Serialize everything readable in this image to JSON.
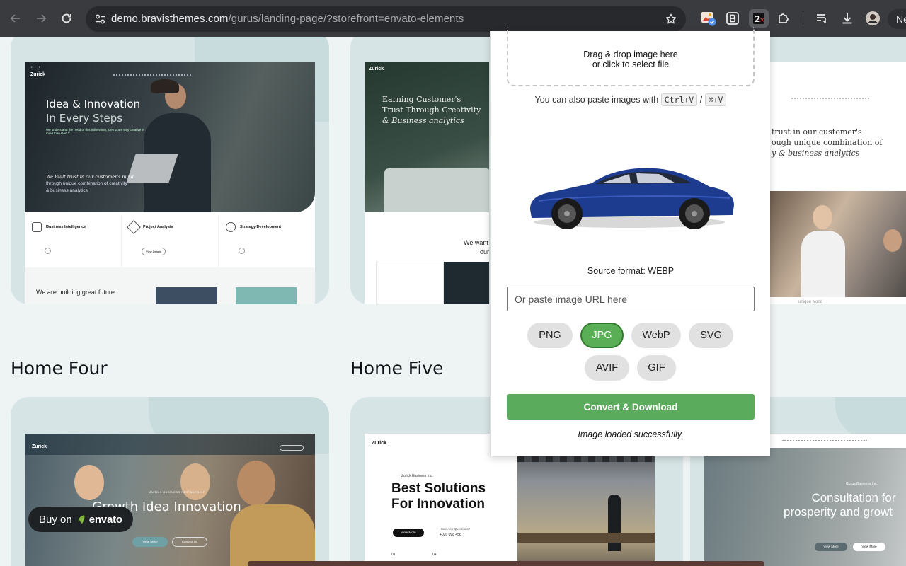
{
  "browser": {
    "url_host": "demo.bravisthemes.com",
    "url_path": "/gurus/landing-page/?storefront=envato-elements",
    "profile_label": "Ne"
  },
  "page": {
    "sections": [
      {
        "title": "Home Four"
      },
      {
        "title": "Home Five"
      }
    ],
    "buy_badge": {
      "prefix": "Buy on",
      "brand": "envato"
    }
  },
  "previews": {
    "home_one": {
      "logo": "Zurick",
      "heading_line1": "Idea & Innovation",
      "heading_line2": "In Every Steps",
      "intro": "We understand the need of this millennium, Gen Z are way creative in mind than Gen X",
      "quote_line1": "We Built trust in our customer's mind",
      "quote_line2": "through unique combination of creativity",
      "quote_line3": "& business analytics",
      "features": [
        "Business Intelligence",
        "Project Analysis",
        "Strategy Development"
      ],
      "view_details": "View Details",
      "tagline": "We are building great future"
    },
    "home_two": {
      "logo": "Zurick",
      "heading_line1": "Earning Customer's",
      "heading_line2": "Trust Through Creativity",
      "heading_line3": "& Business analytics",
      "snippet_line1": "We want",
      "snippet_line2": "our"
    },
    "home_three": {
      "heading_line1": "trust in our customer's",
      "heading_line2": "ough unique combination of",
      "heading_line3": "y & business analytics",
      "footer": "unique world"
    },
    "home_four": {
      "logo": "Zurick",
      "heading": "Growth Idea Innovation",
      "kicker": "ZURICK BUSINESS PARTNERSHIP",
      "btn_primary": "View More",
      "btn_secondary": "Contact Us"
    },
    "home_five": {
      "logo": "Zurick",
      "kicker": "Zurick Business Inc.",
      "heading_line1": "Best Solutions",
      "heading_line2": "For Innovation",
      "btn": "View More",
      "questions": "Have Any Questions?",
      "phone": "+020 098 456",
      "num1": "01",
      "num2": "04"
    },
    "home_six": {
      "kicker": "Gurus Business Inc.",
      "heading_line1": "Consultation for",
      "heading_line2": "prosperity and growt",
      "btn_primary": "View More",
      "btn_secondary": "View More"
    }
  },
  "converter": {
    "dropzone_line1": "Drag & drop image here",
    "dropzone_line2": "or click to select file",
    "paste_hint": "You can also paste images with",
    "shortcut_win": "Ctrl+V",
    "shortcut_sep": "/",
    "shortcut_mac": "⌘+V",
    "preview_alt": "blue sedan car",
    "source_format": "Source format: WEBP",
    "url_placeholder": "Or paste image URL here",
    "formats": [
      {
        "label": "PNG",
        "active": false
      },
      {
        "label": "JPG",
        "active": true
      },
      {
        "label": "WebP",
        "active": false
      },
      {
        "label": "SVG",
        "active": false
      },
      {
        "label": "AVIF",
        "active": false
      },
      {
        "label": "GIF",
        "active": false
      }
    ],
    "convert_label": "Convert & Download",
    "status": "Image loaded successfully.",
    "colors": {
      "button_green": "#5aab5c",
      "active_border": "#2f7a2b"
    }
  }
}
